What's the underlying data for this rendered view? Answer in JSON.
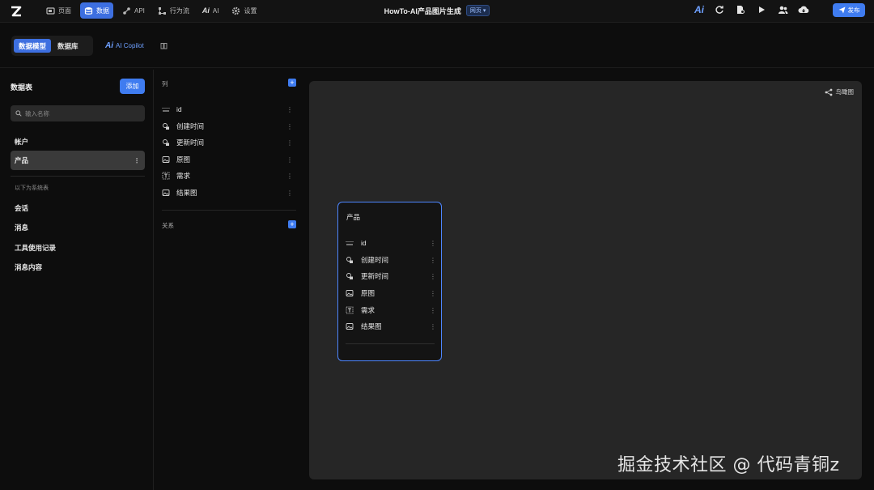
{
  "topbar": {
    "nav": [
      {
        "label": "页面",
        "icon": "pages-icon"
      },
      {
        "label": "数据",
        "icon": "database-icon",
        "active": true
      },
      {
        "label": "API",
        "icon": "api-icon"
      },
      {
        "label": "行为流",
        "icon": "flow-icon"
      },
      {
        "label": "AI",
        "icon": "ai-icon"
      },
      {
        "label": "设置",
        "icon": "gear-icon"
      }
    ],
    "title": "HowTo-AI产品图片生成",
    "title_badge": "网页 ▾",
    "publish_label": "发布"
  },
  "subbar": {
    "tabs": [
      {
        "label": "数据模型",
        "active": true
      },
      {
        "label": "数据库",
        "active": false
      }
    ],
    "copilot_label": "AI Copilot"
  },
  "sidebar": {
    "title": "数据表",
    "add_label": "添加",
    "search_placeholder": "输入名称",
    "tables": [
      "帐户",
      "产品"
    ],
    "active_table": "产品",
    "system_section_label": "以下为系统表",
    "system_tables": [
      "会话",
      "消息",
      "工具使用记录",
      "消息内容"
    ]
  },
  "columns_panel": {
    "columns_header": "列",
    "columns": [
      {
        "name": "id",
        "icon": "id-icon"
      },
      {
        "name": "创建时间",
        "icon": "datetime-icon"
      },
      {
        "name": "更新时间",
        "icon": "datetime-icon"
      },
      {
        "name": "原图",
        "icon": "image-icon"
      },
      {
        "name": "需求",
        "icon": "text-icon"
      },
      {
        "name": "结果图",
        "icon": "image-icon"
      }
    ],
    "relations_header": "关系"
  },
  "canvas": {
    "birdseye_label": "鸟瞰图",
    "card": {
      "title": "产品",
      "rows": [
        "id",
        "创建时间",
        "更新时间",
        "原图",
        "需求",
        "结果图"
      ]
    }
  },
  "watermark": "掘金技术社区 @ 代码青铜z",
  "colors": {
    "accent": "#3f7cf0",
    "card_border": "#4d86ff",
    "canvas_bg": "#262626",
    "app_bg": "#0d0d0d"
  }
}
